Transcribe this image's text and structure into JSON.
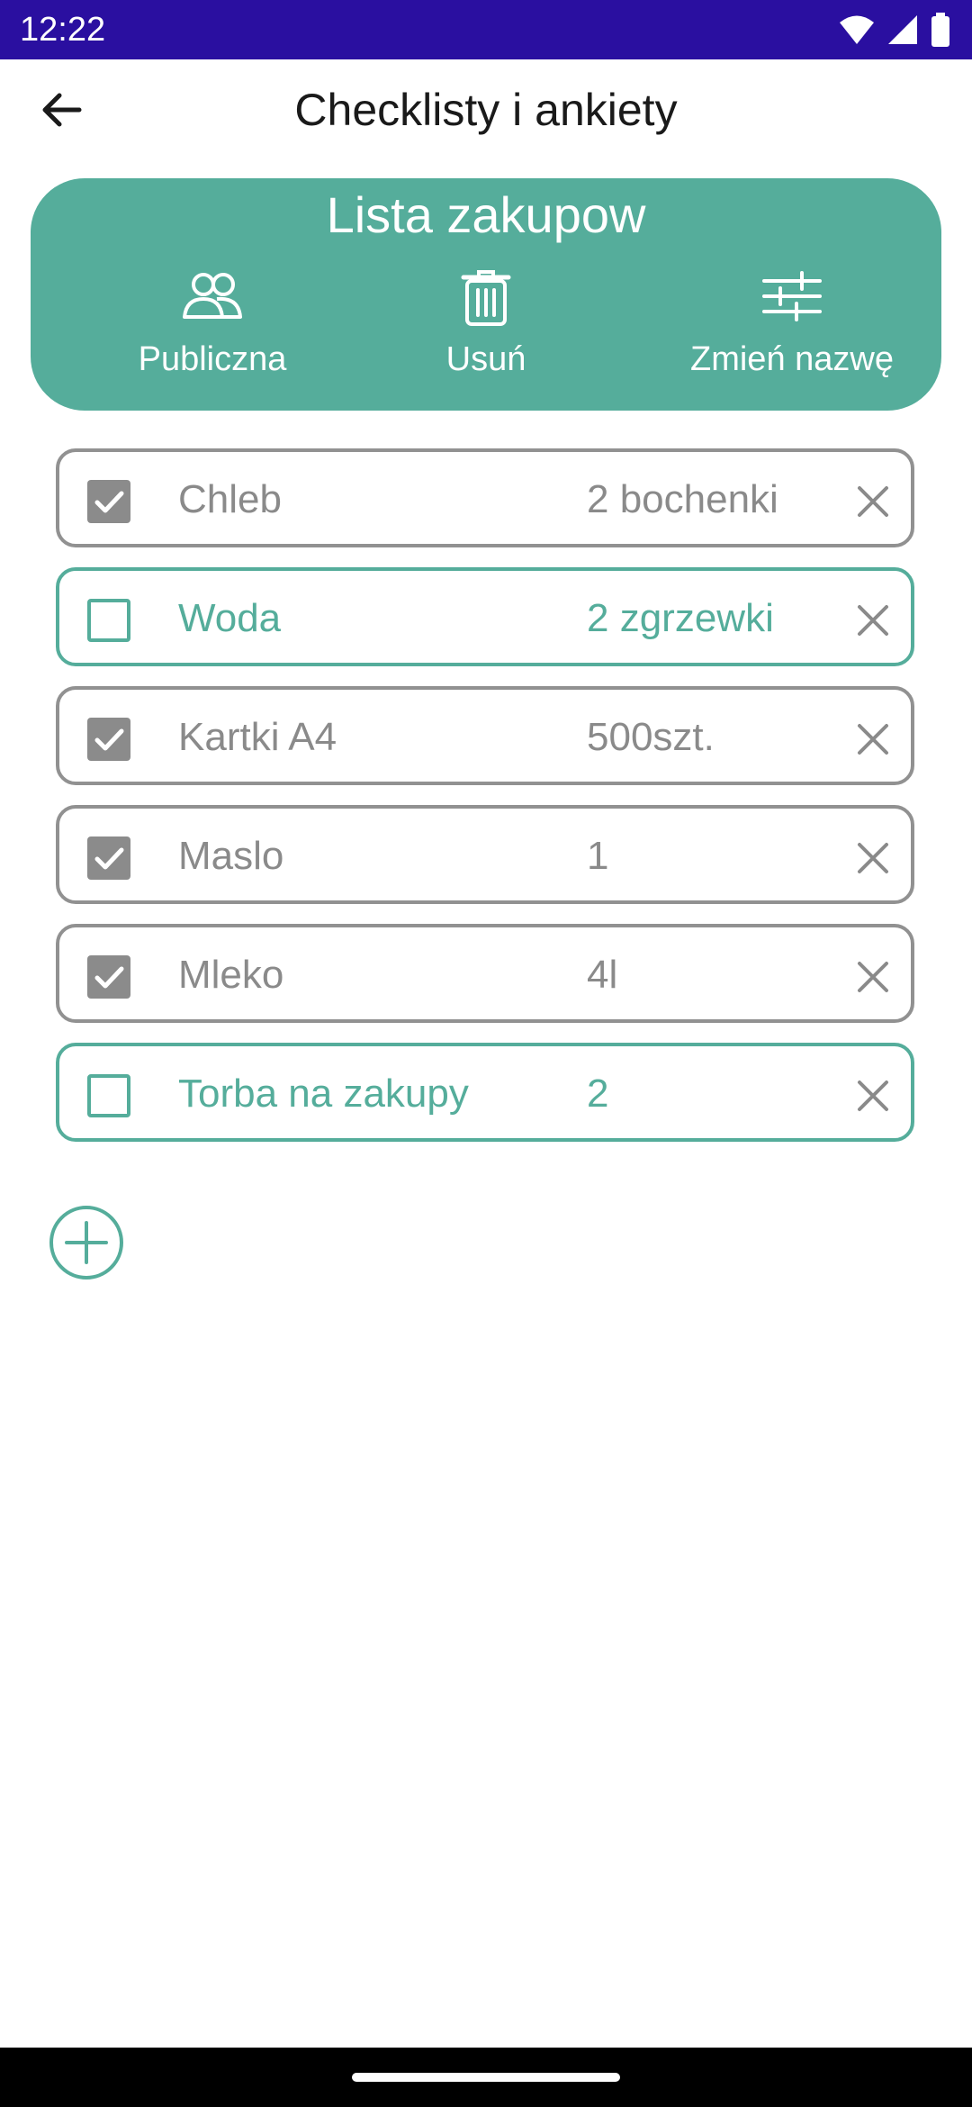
{
  "status_bar": {
    "time": "12:22",
    "icons": [
      "wifi-icon",
      "signal-icon",
      "battery-icon"
    ]
  },
  "app_bar": {
    "title": "Checklisty i ankiety",
    "back_icon": "arrow-left-icon"
  },
  "list_header": {
    "title": "Lista zakupow",
    "actions": [
      {
        "label": "Publiczna",
        "icon": "people-icon"
      },
      {
        "label": "Usuń",
        "icon": "trash-icon"
      },
      {
        "label": "Zmień nazwę",
        "icon": "sliders-icon"
      }
    ]
  },
  "items": [
    {
      "name": "Chleb",
      "quantity": "2 bochenki",
      "checked": true
    },
    {
      "name": "Woda",
      "quantity": "2 zgrzewki",
      "checked": false
    },
    {
      "name": "Kartki A4",
      "quantity": "500szt.",
      "checked": true
    },
    {
      "name": "Maslo",
      "quantity": "1",
      "checked": true
    },
    {
      "name": "Mleko",
      "quantity": "4l",
      "checked": true
    },
    {
      "name": "Torba na zakupy",
      "quantity": "2",
      "checked": false
    }
  ],
  "add_button": {
    "icon": "plus-circle-icon"
  },
  "colors": {
    "status_bar": "#2a0fa0",
    "accent": "#55ad9b",
    "checked_gray": "#8a8a8a",
    "navigation_bar": "#000000"
  }
}
